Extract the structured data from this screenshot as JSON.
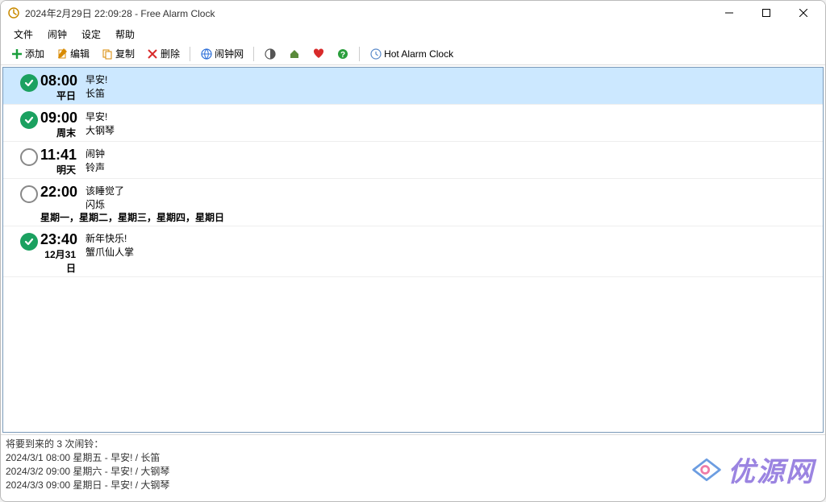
{
  "titlebar": {
    "title": "2024年2月29日 22:09:28 - Free Alarm Clock"
  },
  "menubar": {
    "file": "文件",
    "alarm": "闹钟",
    "settings": "设定",
    "help": "帮助"
  },
  "toolbar": {
    "add": "添加",
    "edit": "编辑",
    "copy": "复制",
    "delete": "删除",
    "alarm_net": "闹钟网",
    "hot_alarm": "Hot Alarm Clock"
  },
  "alarms": [
    {
      "time": "08:00",
      "schedule": "平日",
      "label": "早安!",
      "sound": "长笛",
      "enabled": true,
      "selected": true,
      "wide": false
    },
    {
      "time": "09:00",
      "schedule": "周末",
      "label": "早安!",
      "sound": "大钢琴",
      "enabled": true,
      "selected": false,
      "wide": false
    },
    {
      "time": "11:41",
      "schedule": "明天",
      "label": "闹钟",
      "sound": "铃声",
      "enabled": false,
      "selected": false,
      "wide": false
    },
    {
      "time": "22:00",
      "schedule": "星期一，星期二，星期三，星期四，星期日",
      "label": "该睡觉了",
      "sound": "闪烁",
      "enabled": false,
      "selected": false,
      "wide": true
    },
    {
      "time": "23:40",
      "schedule": "12月31日",
      "label": "新年快乐!",
      "sound": "蟹爪仙人掌",
      "enabled": true,
      "selected": false,
      "wide": false
    }
  ],
  "upcoming": {
    "title": "将要到来的 3 次闹铃：",
    "items": [
      "2024/3/1 08:00 星期五 - 早安! / 长笛",
      "2024/3/2 09:00 星期六 - 早安! / 大钢琴",
      "2024/3/3 09:00 星期日 - 早安! / 大钢琴"
    ]
  },
  "watermark": {
    "text": "优源网"
  }
}
